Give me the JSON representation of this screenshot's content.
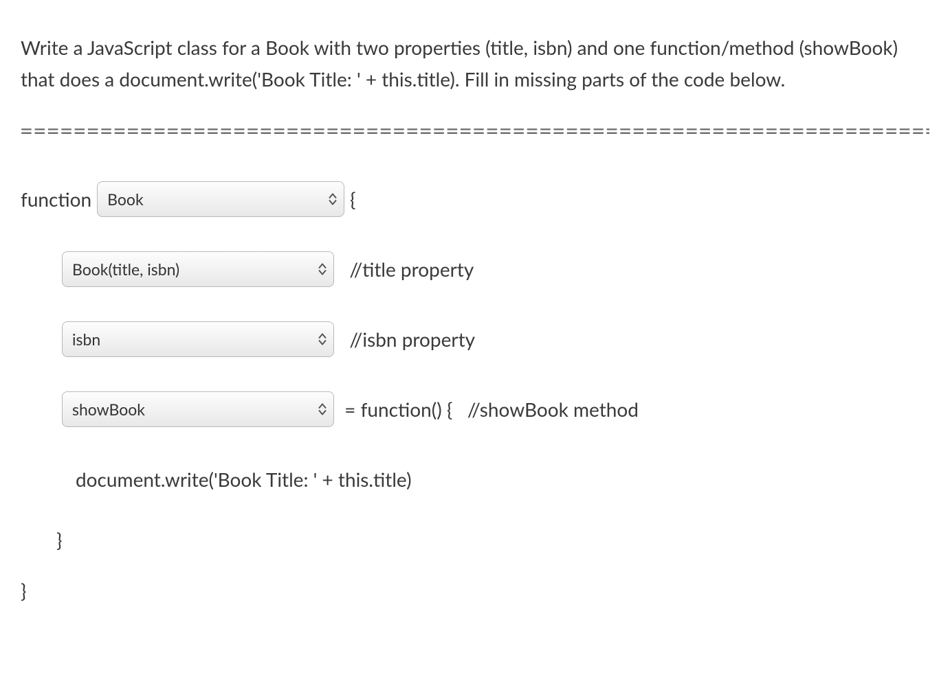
{
  "prompt": "Write a JavaScript class for a Book with two properties (title, isbn) and one function/method (showBook) that does a document.write('Book Title: ' + this.title). Fill in missing parts of the code below.",
  "divider": "====================================================================================",
  "code": {
    "line1_prefix": "function",
    "line1_dropdown": "Book",
    "line1_suffix": "{",
    "line2_dropdown": "Book(title, isbn)",
    "line2_comment": "//title property",
    "line3_dropdown": "isbn",
    "line3_comment": "//isbn property",
    "line4_dropdown": "showBook",
    "line4_suffix": "= function() {   //showBook method",
    "line5": "document.write('Book Title: ' + this.title)",
    "line6": "}",
    "line7": "}"
  }
}
